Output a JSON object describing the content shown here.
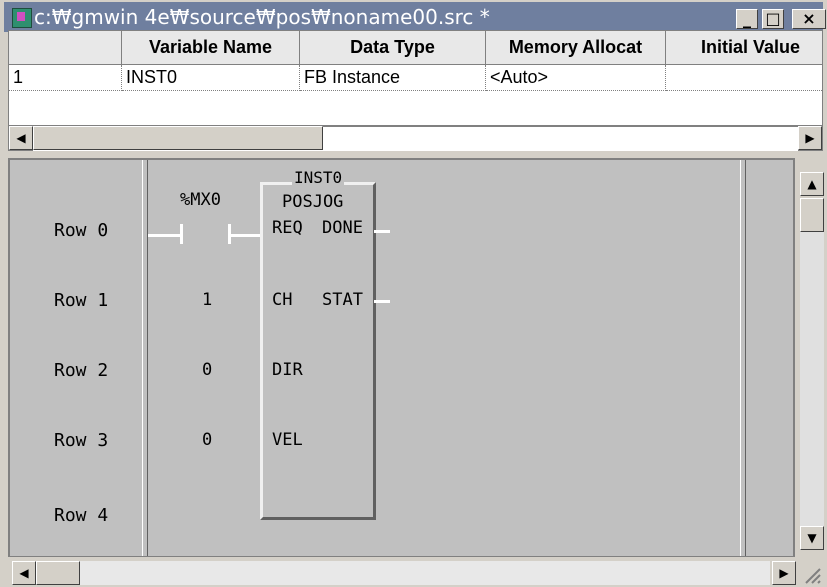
{
  "window": {
    "title": "c:₩gmwin 4e₩source₩pos₩noname00.src *"
  },
  "titlebar_buttons": {
    "minimize": "_",
    "maximize": "□",
    "close": "×"
  },
  "variables": {
    "headers": [
      "",
      "Variable Name",
      "Data Type",
      "Memory Allocat",
      "Initial Value"
    ],
    "rows": [
      {
        "index": "1",
        "name": "INST0",
        "type": "FB Instance",
        "memory": "<Auto>",
        "initial": ""
      }
    ]
  },
  "ladder": {
    "rows": [
      "Row 0",
      "Row 1",
      "Row 2",
      "Row 3",
      "Row 4"
    ],
    "contact": "%MX0",
    "fb": {
      "instance": "INST0",
      "type": "POSJOG",
      "inputs": [
        "REQ",
        "CH",
        "DIR",
        "VEL"
      ],
      "outputs": [
        "DONE",
        "STAT"
      ],
      "input_values": [
        "1",
        "0",
        "0"
      ]
    }
  },
  "icons": {
    "scroll_left": "◀",
    "scroll_right": "▶",
    "scroll_up": "▲",
    "scroll_down": "▼"
  }
}
